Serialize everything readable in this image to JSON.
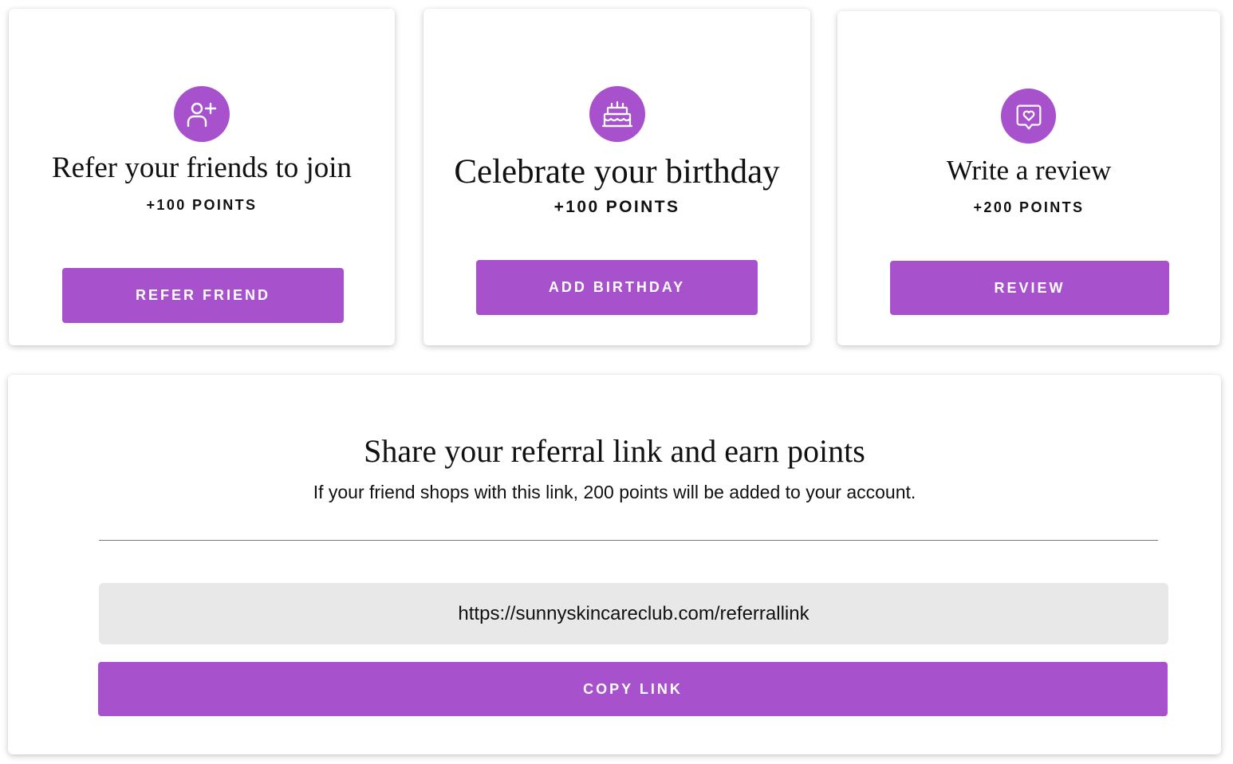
{
  "colors": {
    "accent": "#a752cc",
    "field_background": "#e8e8e8"
  },
  "cards": [
    {
      "icon": "add-user-icon",
      "title": "Refer your friends to join",
      "points": "+100 POINTS",
      "button_label": "REFER FRIEND"
    },
    {
      "icon": "birthday-cake-icon",
      "title": "Celebrate your birthday",
      "points": "+100 POINTS",
      "button_label": "ADD BIRTHDAY"
    },
    {
      "icon": "review-heart-icon",
      "title": "Write a review",
      "points": "+200 POINTS",
      "button_label": "REVIEW"
    }
  ],
  "share": {
    "title": "Share your referral link and earn points",
    "subtitle": "If your friend shops with this link, 200 points will be added to your account.",
    "link_value": "https://sunnyskincareclub.com/referrallink",
    "copy_label": "COPY LINK"
  }
}
